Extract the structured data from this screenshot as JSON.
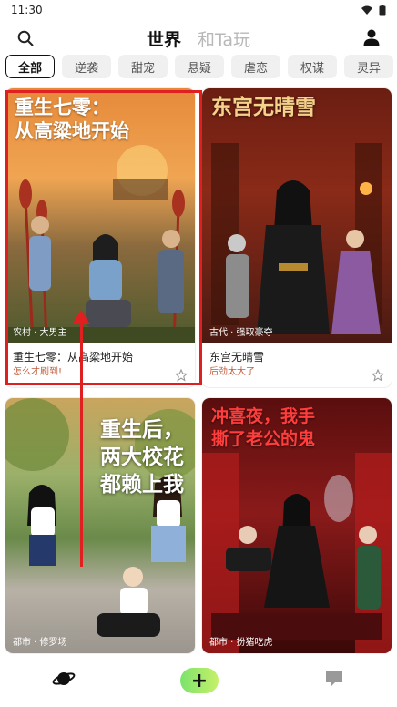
{
  "status": {
    "time": "11:30"
  },
  "header": {
    "tabs": [
      {
        "label": "世界"
      },
      {
        "label": "和Ta玩"
      }
    ]
  },
  "categories": [
    "全部",
    "逆袭",
    "甜宠",
    "悬疑",
    "虐恋",
    "权谋",
    "灵异"
  ],
  "cards": [
    {
      "cover_title": "重生七零：\n从高粱地开始",
      "tag": "农村 · 大男主",
      "title": "重生七零：从高粱地开始",
      "sub": "怎么才刷到!"
    },
    {
      "cover_title": "东宫无晴雪",
      "tag": "古代 · 强取豪夺",
      "title": "东宫无晴雪",
      "sub": "后劲太大了"
    },
    {
      "cover_title": "重生后，\n两大校花\n都赖上我",
      "tag": "都市 · 修罗场"
    },
    {
      "cover_title": "冲喜夜，我手\n撕了老公的鬼",
      "tag": "都市 · 扮猪吃虎"
    }
  ],
  "colors": {
    "accent_red": "#e02020",
    "add_green": "#7be36c"
  }
}
